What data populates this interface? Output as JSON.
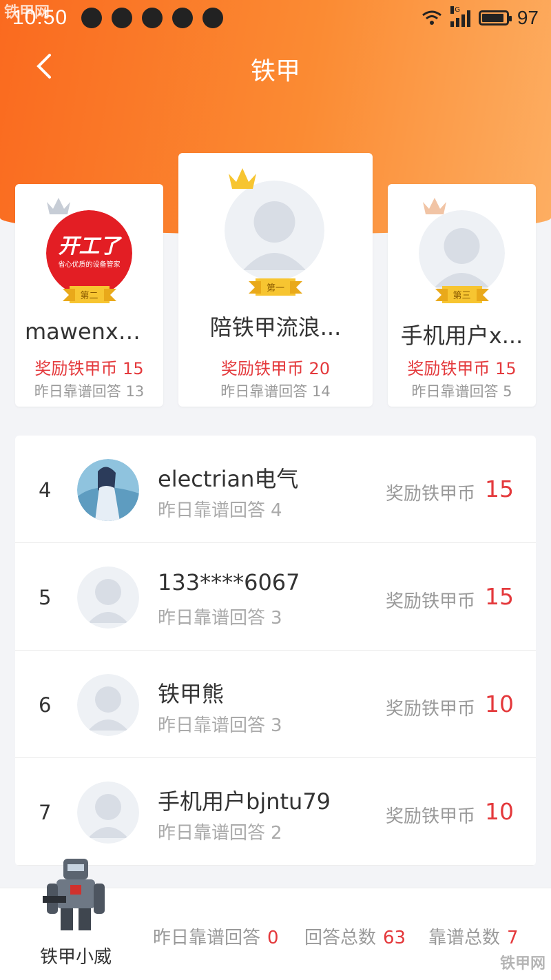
{
  "status_bar": {
    "time": "10:50",
    "battery": "97",
    "network": "4G"
  },
  "header": {
    "title": "铁甲"
  },
  "podium": [
    {
      "rank_label": "第二",
      "name": "mawenxuan",
      "reward_label": "奖励铁甲币",
      "reward": "15",
      "yest_label": "昨日靠谱回答",
      "yest": "13",
      "avatar_text1": "开工了",
      "avatar_text2": "省心优质的设备管家"
    },
    {
      "rank_label": "第一",
      "name": "陪铁甲流浪...",
      "reward_label": "奖励铁甲币",
      "reward": "20",
      "yest_label": "昨日靠谱回答",
      "yest": "14"
    },
    {
      "rank_label": "第三",
      "name": "手机用户x...",
      "reward_label": "奖励铁甲币",
      "reward": "15",
      "yest_label": "昨日靠谱回答",
      "yest": "5"
    }
  ],
  "list": [
    {
      "rank": "4",
      "name": "electrian电气",
      "yest_label": "昨日靠谱回答",
      "yest": "4",
      "reward_label": "奖励铁甲币",
      "reward": "15"
    },
    {
      "rank": "5",
      "name": "133****6067",
      "yest_label": "昨日靠谱回答",
      "yest": "3",
      "reward_label": "奖励铁甲币",
      "reward": "15"
    },
    {
      "rank": "6",
      "name": "铁甲熊",
      "yest_label": "昨日靠谱回答",
      "yest": "3",
      "reward_label": "奖励铁甲币",
      "reward": "10"
    },
    {
      "rank": "7",
      "name": "手机用户bjntu79",
      "yest_label": "昨日靠谱回答",
      "yest": "2",
      "reward_label": "奖励铁甲币",
      "reward": "10"
    }
  ],
  "me": {
    "name": "铁甲小威",
    "yest_label": "昨日靠谱回答",
    "yest": "0",
    "total_label": "回答总数",
    "total": "63",
    "reliable_label": "靠谱总数",
    "reliable": "7"
  },
  "watermark": {
    "top": "铁甲网",
    "bottom": "铁甲网"
  },
  "colors": {
    "accent": "#fa6a1f",
    "reward": "#e4393c"
  }
}
